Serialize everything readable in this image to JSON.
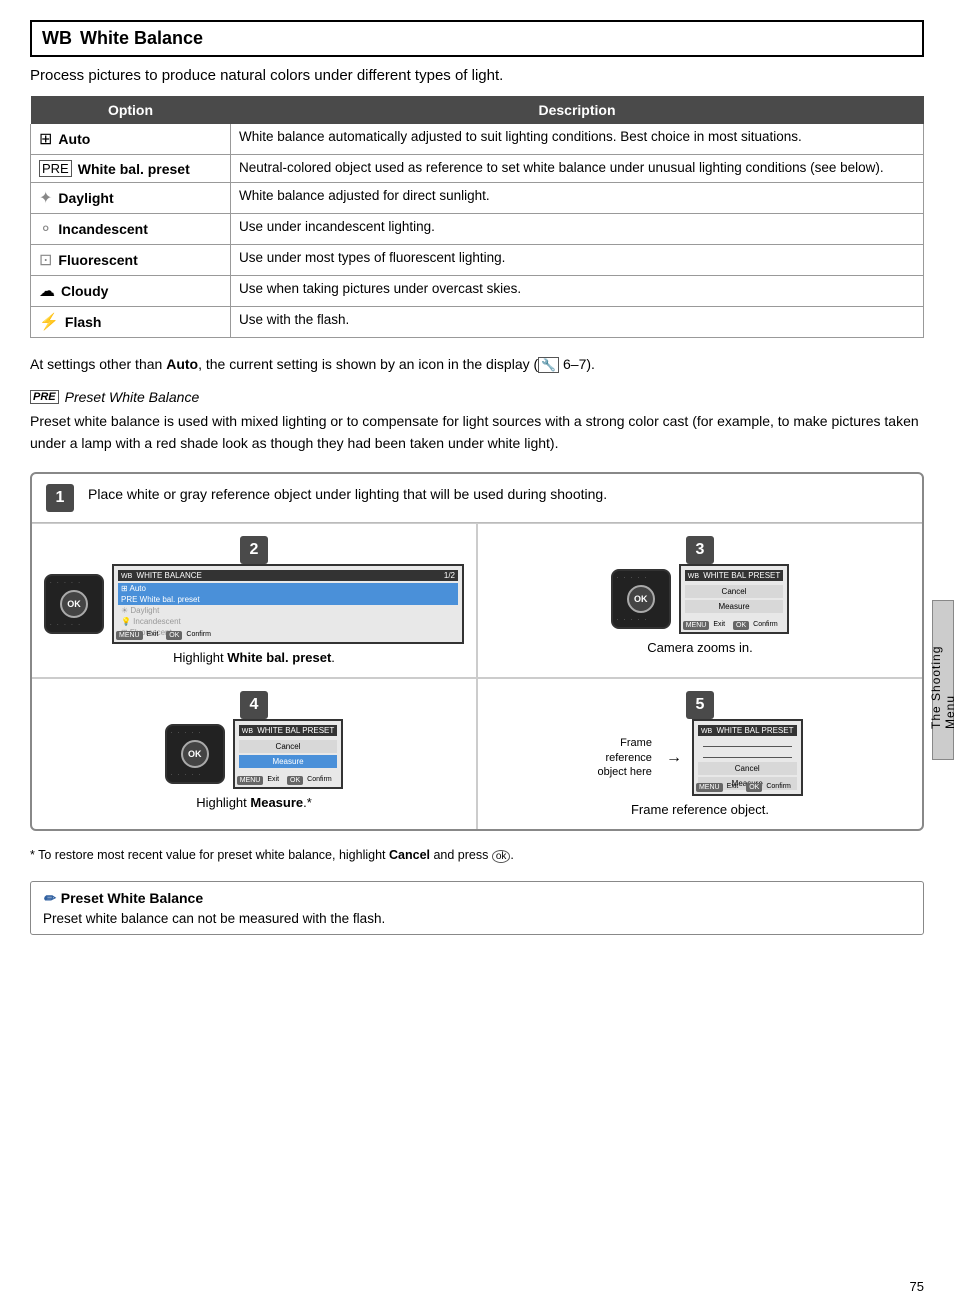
{
  "header": {
    "icon": "WB",
    "title": "White Balance"
  },
  "intro": "Process pictures to produce natural colors under different types of light.",
  "table": {
    "col1": "Option",
    "col2": "Description",
    "rows": [
      {
        "icon": "⊞",
        "name": "Auto",
        "desc": "White balance automatically adjusted to suit lighting conditions. Best choice in most situations."
      },
      {
        "icon": "PRE",
        "name": "White bal. preset",
        "desc": "Neutral-colored object used as reference to set white balance under unusual lighting conditions (see below)."
      },
      {
        "icon": "☀",
        "name": "Daylight",
        "desc": "White balance adjusted for direct sunlight."
      },
      {
        "icon": "💡",
        "name": "Incandescent",
        "desc": "Use under incandescent lighting."
      },
      {
        "icon": "⊞",
        "name": "Fluorescent",
        "desc": "Use under most types of fluorescent lighting."
      },
      {
        "icon": "☁",
        "name": "Cloudy",
        "desc": "Use when taking pictures under overcast skies."
      },
      {
        "icon": "⚡",
        "name": "Flash",
        "desc": "Use with the flash."
      }
    ]
  },
  "auto_note": "At settings other than Auto, the current setting is shown by an icon in the display (🔧 6–7).",
  "preset_heading_icon": "PRE",
  "preset_heading": "Preset White Balance",
  "preset_desc": "Preset white balance is used with mixed lighting or to compensate for light sources with a strong color cast (for example, to make pictures taken under a lamp with a red shade look as though they had been taken under white light).",
  "steps": {
    "step1": {
      "num": "1",
      "text": "Place white or gray reference object under lighting that will be used during shooting."
    },
    "step2": {
      "num": "2",
      "caption_prefix": "Highlight ",
      "caption_bold": "White bal. preset",
      "caption_suffix": ".",
      "screen_title": "WHITE BALANCE",
      "screen_page": "1/2",
      "menu_items": [
        {
          "label": "Auto",
          "icon": "⊞",
          "state": "selected"
        },
        {
          "label": "White bal. preset",
          "icon": "PRE",
          "state": "highlighted"
        },
        {
          "label": "Daylight",
          "icon": "☀",
          "state": "dimmed"
        },
        {
          "label": "Incandescent",
          "icon": "💡",
          "state": "dimmed"
        },
        {
          "label": "Fluorescent",
          "icon": "⊞",
          "state": "dimmed"
        }
      ],
      "footer_left": "MENU Exit",
      "footer_right": "OK Confirm"
    },
    "step3": {
      "num": "3",
      "caption": "Camera zooms in.",
      "screen_title": "WHITE BAL PRESET",
      "menu_items": [
        {
          "label": "Cancel"
        },
        {
          "label": "Measure"
        }
      ],
      "footer_left": "MENU Exit",
      "footer_right": "OK Confirm"
    },
    "step4": {
      "num": "4",
      "caption_prefix": "Highlight ",
      "caption_bold": "Measure",
      "caption_suffix": ".*",
      "screen_title": "WHITE BAL PRESET",
      "menu_items": [
        {
          "label": "Cancel"
        },
        {
          "label": "Measure",
          "state": "selected"
        }
      ],
      "footer_left": "MENU Exit",
      "footer_right": "OK Confirm"
    },
    "step5": {
      "num": "5",
      "frame_label": "Frame\nreference\nobject here",
      "caption": "Frame reference object.",
      "screen_title": "WHITE BAL PRESET",
      "menu_items": [
        {
          "label": "Cancel"
        },
        {
          "label": "Measure"
        }
      ],
      "footer_left": "MENU Exit",
      "footer_right": "OK Confirm"
    }
  },
  "footnote": "* To restore most recent value for preset white balance, highlight Cancel and press ok.",
  "note": {
    "icon": "✏",
    "heading": "Preset White Balance",
    "text": "Preset white balance can not be measured with the flash."
  },
  "side_tab": "The Shooting Menu",
  "page_num": "75"
}
